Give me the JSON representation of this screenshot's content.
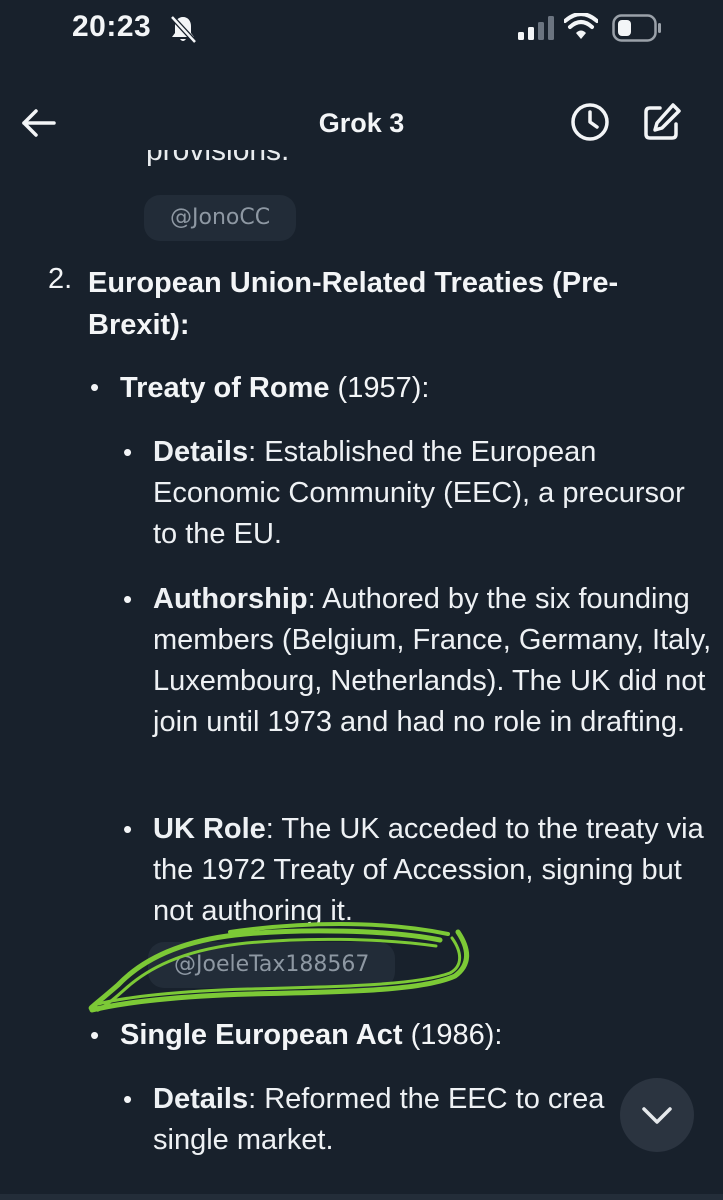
{
  "status_bar": {
    "time": "20:23",
    "icons": [
      "bell-slash-icon",
      "signal-icon",
      "wifi-icon",
      "battery-icon"
    ]
  },
  "header": {
    "title": "Grok 3",
    "icons": [
      "back-arrow-icon",
      "history-icon",
      "new-chat-icon"
    ]
  },
  "message": {
    "clipped_top_text": "provisions.",
    "source_chip_1": "@JonoCC",
    "section_number": "2.",
    "section_title": "European Union-Related Treaties (Pre-Brexit)",
    "section_colon": ":",
    "treaty_1": {
      "name": "Treaty of Rome",
      "year_suffix": " (1957):",
      "details_label": "Details",
      "details_text": ": Established the European Economic Community (EEC), a precursor to the EU.",
      "authorship_label": "Authorship",
      "authorship_text": ": Authored by the six founding members (Belgium, France, Germany, Italy, Luxembourg, Netherlands). The UK did not join until 1973 and had no role in drafting.",
      "uk_role_label": "UK Role",
      "uk_role_text": ": The UK acceded to the treaty via the 1972 Treaty of Accession, signing but not authoring it."
    },
    "source_chip_2": "@JoeleTax188567",
    "treaty_2": {
      "name": "Single European Act",
      "year_suffix": " (1986):",
      "details_label": "Details",
      "details_text": ": Reformed the EEC to crea",
      "details_text_line2": "single market."
    }
  },
  "colors": {
    "background": "#18212c",
    "text": "#f3f5f7",
    "chip_background": "#222c38",
    "chip_text": "#8e98a3",
    "highlighter": "#7cc936"
  }
}
